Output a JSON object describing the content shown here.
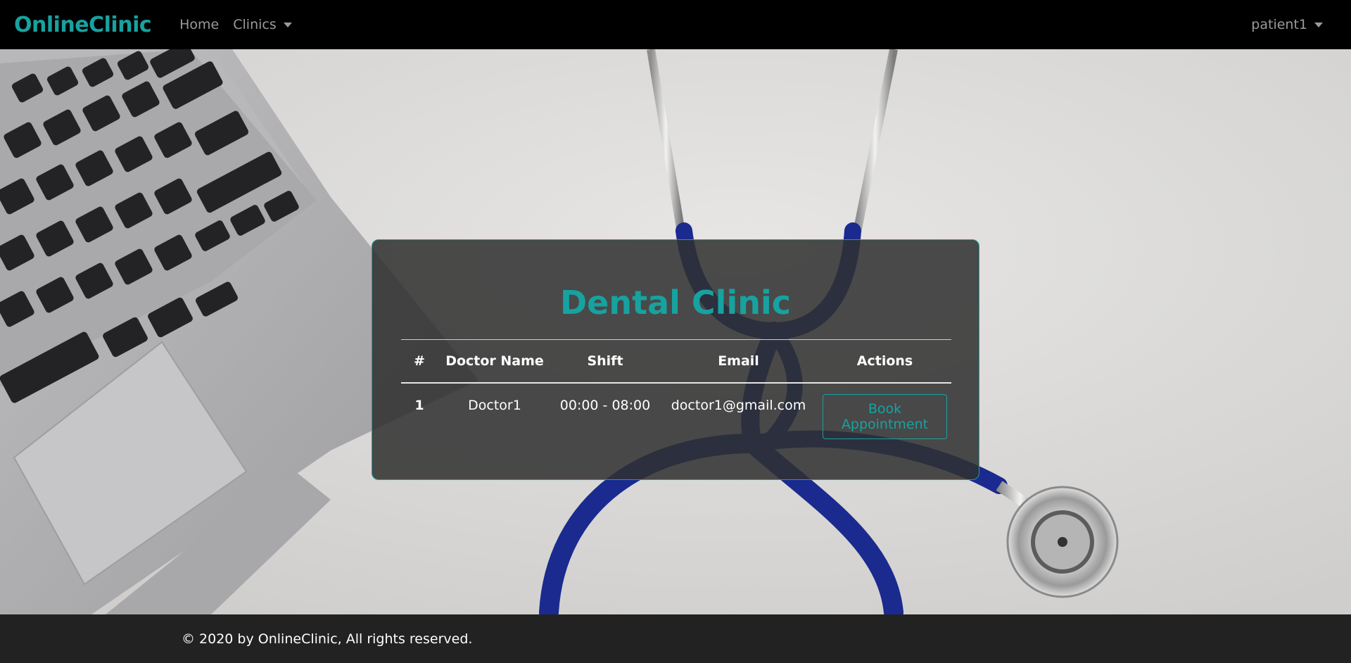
{
  "navbar": {
    "brand": "OnlineClinic",
    "links": [
      "Home",
      "Clinics"
    ],
    "user": "patient1"
  },
  "card": {
    "title": "Dental Clinic",
    "table": {
      "headers": [
        "#",
        "Doctor Name",
        "Shift",
        "Email",
        "Actions"
      ],
      "rows": [
        {
          "num": "1",
          "name": "Doctor1",
          "shift": "00:00 - 08:00",
          "email": "doctor1@gmail.com",
          "action": "Book Appointment"
        }
      ]
    }
  },
  "footer": {
    "text": "© 2020 by OnlineClinic, All rights reserved."
  },
  "colors": {
    "accent": "#17a2a0",
    "navbar": "#000000",
    "footer": "#222222"
  }
}
